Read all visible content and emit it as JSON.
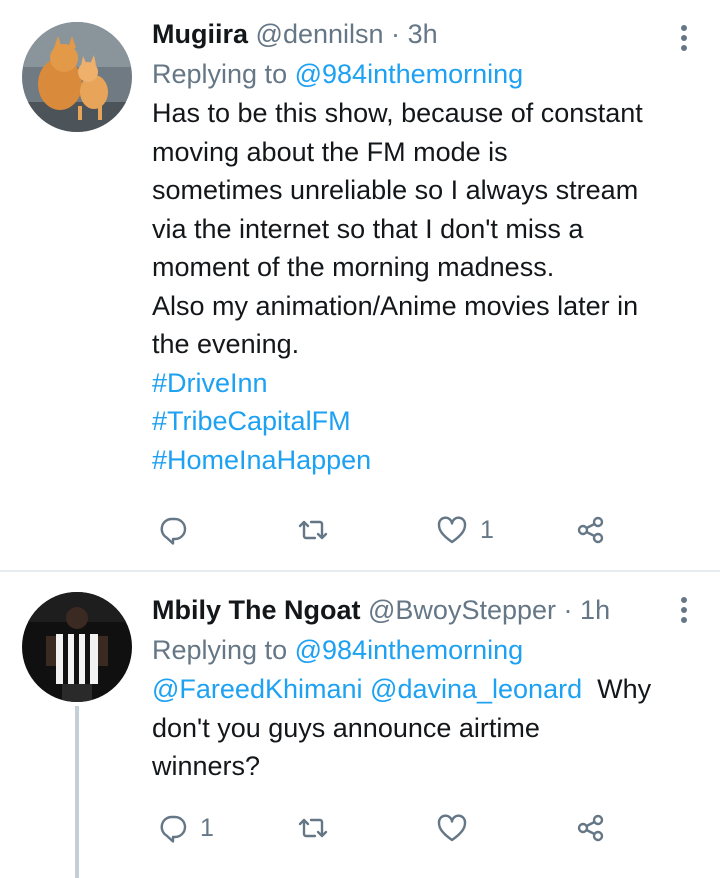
{
  "tweets": [
    {
      "name": "Mugiira",
      "handle": "@dennilsn",
      "separator": "·",
      "time": "3h",
      "replying_prefix": "Replying to",
      "replying_to": "@984inthemorning",
      "text_lines": [
        "Has to be this show, because of constant",
        "moving about the FM mode is",
        "sometimes unreliable so I always stream",
        "via the internet so that I don't miss a",
        "moment of the morning madness.",
        "Also my animation/Anime movies later in",
        "the evening."
      ],
      "hashtags": [
        "#DriveInn",
        "#TribeCapitalFM",
        "#HomeInaHappen"
      ],
      "reply_count": "",
      "retweet_count": "",
      "like_count": "1"
    },
    {
      "name": "Mbily The Ngoat",
      "handle": "@BwoyStepper",
      "separator": "·",
      "time": "1h",
      "replying_prefix": "Replying to",
      "replying_to": "@984inthemorning",
      "mention_1": "@FareedKhimani",
      "mention_2": "@davina_leonard",
      "text_first": "Why",
      "text_lines": [
        "don't you guys announce airtime",
        "winners?"
      ],
      "reply_count": "1",
      "retweet_count": "",
      "like_count": ""
    }
  ],
  "icons": {
    "reply": "reply-icon",
    "retweet": "retweet-icon",
    "like": "heart-icon",
    "share": "share-icon",
    "more": "more-vertical-icon"
  },
  "colors": {
    "link": "#1da1f2",
    "secondary": "#657786",
    "text": "#14171a",
    "divider": "#e6ecf0"
  }
}
